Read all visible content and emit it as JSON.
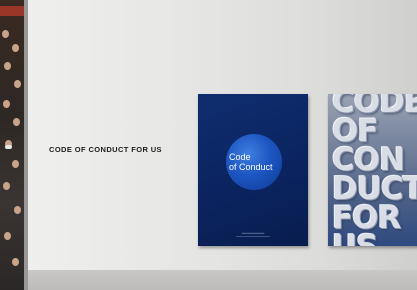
{
  "wall": {
    "caption": "CODE OF CONDUCT FOR US"
  },
  "poster_left": {
    "title_line1": "Code",
    "title_line2": "of Conduct"
  },
  "poster_right": {
    "letters": "CODE\nOF\nCON\nDUCT\nFOR\nUS"
  },
  "colors": {
    "poster_left_bg": "#0b2460",
    "poster_left_sphere": "#1d56c2",
    "wall": "#e6e6e4"
  }
}
